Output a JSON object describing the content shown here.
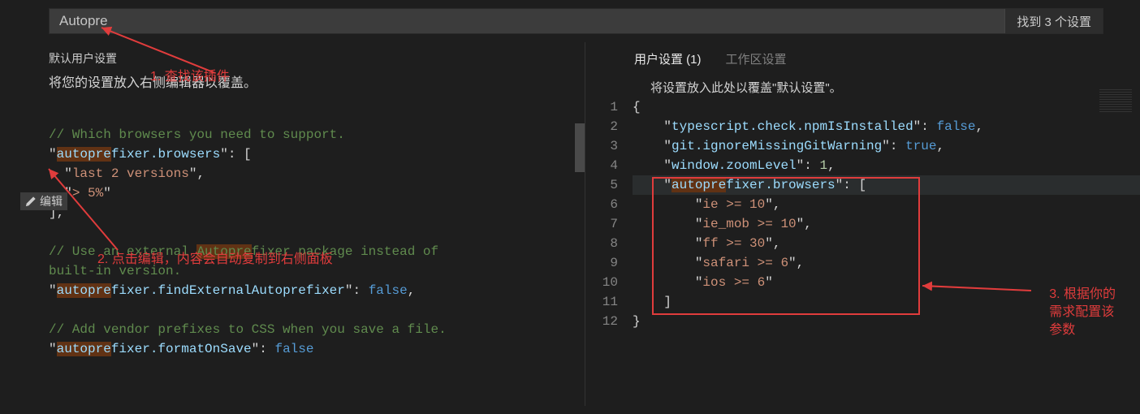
{
  "search": {
    "value": "Autopre",
    "result": "找到 3 个设置"
  },
  "left": {
    "title": "默认用户设置",
    "desc": "将您的设置放入右侧编辑器以覆盖。",
    "edit_label": "编辑"
  },
  "left_code": {
    "c1": "// Which browsers you need to support.",
    "k1a": "auto",
    "k1b": "pre",
    "k1c": "fixer.browsers",
    "s1": "last 2 versions",
    "s2": "> 5%",
    "c2a": "// Use an external ",
    "c2b": "Autopre",
    "c2c": "fixer package instead of",
    "c3": "built-in version.",
    "k2a": "auto",
    "k2b": "pre",
    "k2c": "fixer.findExternalAutoprefixer",
    "v2": "false",
    "c4": "// Add vendor prefixes to CSS when you save a file.",
    "k3a": "auto",
    "k3b": "pre",
    "k3c": "fixer.formatOnSave",
    "v3": "false"
  },
  "right": {
    "tab_user": "用户设置 (1)",
    "tab_ws": "工作区设置",
    "desc": "将设置放入此处以覆盖\"默认设置\"。"
  },
  "right_code": {
    "k1": "typescript.check.npmIsInstalled",
    "v1": "false",
    "k2": "git.ignoreMissingGitWarning",
    "v2": "true",
    "k3": "window.zoomLevel",
    "v3": "1",
    "k4a": "auto",
    "k4b": "pre",
    "k4c": "fixer.browsers",
    "a1": "ie >= 10",
    "a2": "ie_mob >= 10",
    "a3": "ff >= 30",
    "a4": "safari >= 6",
    "a5": "ios >= 6"
  },
  "line_numbers": [
    "1",
    "2",
    "3",
    "4",
    "5",
    "6",
    "7",
    "8",
    "9",
    "10",
    "11",
    "12"
  ],
  "annotations": {
    "a1": "1. 查找该插件",
    "a2": "2. 点击编辑，内容会自动复制到右侧面板",
    "a3a": "3. 根据你的",
    "a3b": "需求配置该",
    "a3c": "参数"
  }
}
